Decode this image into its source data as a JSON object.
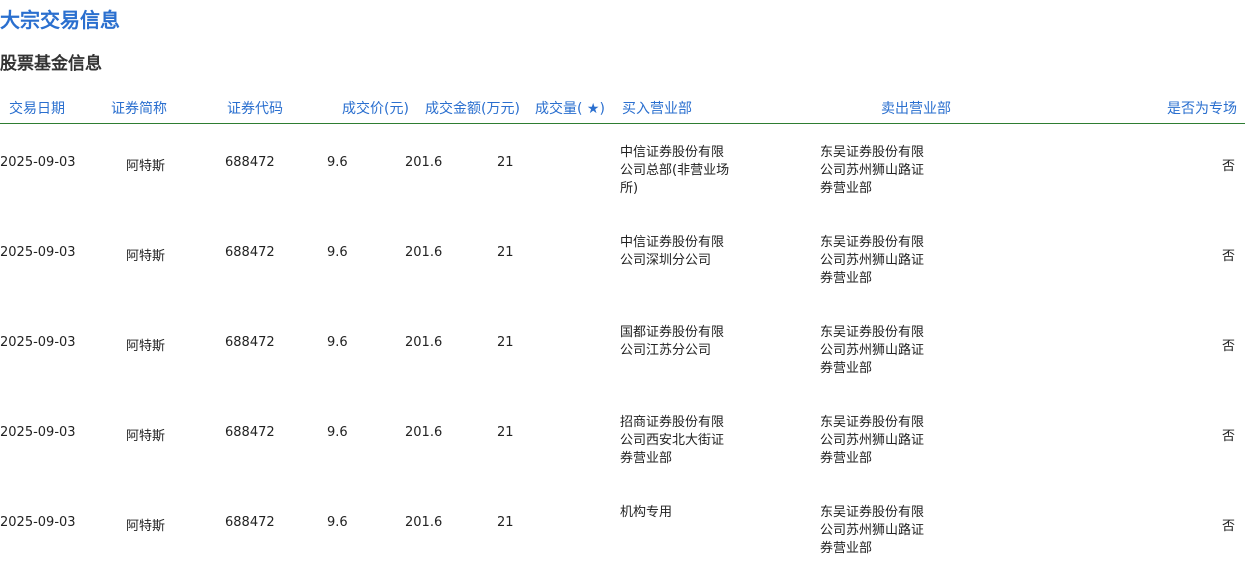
{
  "page_title": "大宗交易信息",
  "section_title": "股票基金信息",
  "columns": [
    "交易日期",
    "证券简称",
    "证券代码",
    "成交价(元)",
    "成交金额(万元)",
    "成交量( ★)",
    "买入营业部",
    "卖出营业部",
    "是否为专场"
  ],
  "rows": [
    {
      "date": "2025-09-03",
      "name": "阿特斯",
      "code": "688472",
      "price": "9.6",
      "amount": "201.6",
      "volume": "21",
      "buyer": "中信证券股份有限公司总部(非营业场所)",
      "seller": "东吴证券股份有限公司苏州狮山路证券营业部",
      "special": "否"
    },
    {
      "date": "2025-09-03",
      "name": "阿特斯",
      "code": "688472",
      "price": "9.6",
      "amount": "201.6",
      "volume": "21",
      "buyer": "中信证券股份有限公司深圳分公司",
      "seller": "东吴证券股份有限公司苏州狮山路证券营业部",
      "special": "否"
    },
    {
      "date": "2025-09-03",
      "name": "阿特斯",
      "code": "688472",
      "price": "9.6",
      "amount": "201.6",
      "volume": "21",
      "buyer": "国都证券股份有限公司江苏分公司",
      "seller": "东吴证券股份有限公司苏州狮山路证券营业部",
      "special": "否"
    },
    {
      "date": "2025-09-03",
      "name": "阿特斯",
      "code": "688472",
      "price": "9.6",
      "amount": "201.6",
      "volume": "21",
      "buyer": "招商证券股份有限公司西安北大街证券营业部",
      "seller": "东吴证券股份有限公司苏州狮山路证券营业部",
      "special": "否"
    },
    {
      "date": "2025-09-03",
      "name": "阿特斯",
      "code": "688472",
      "price": "9.6",
      "amount": "201.6",
      "volume": "21",
      "buyer": "机构专用",
      "seller": "东吴证券股份有限公司苏州狮山路证券营业部",
      "special": "否"
    }
  ]
}
